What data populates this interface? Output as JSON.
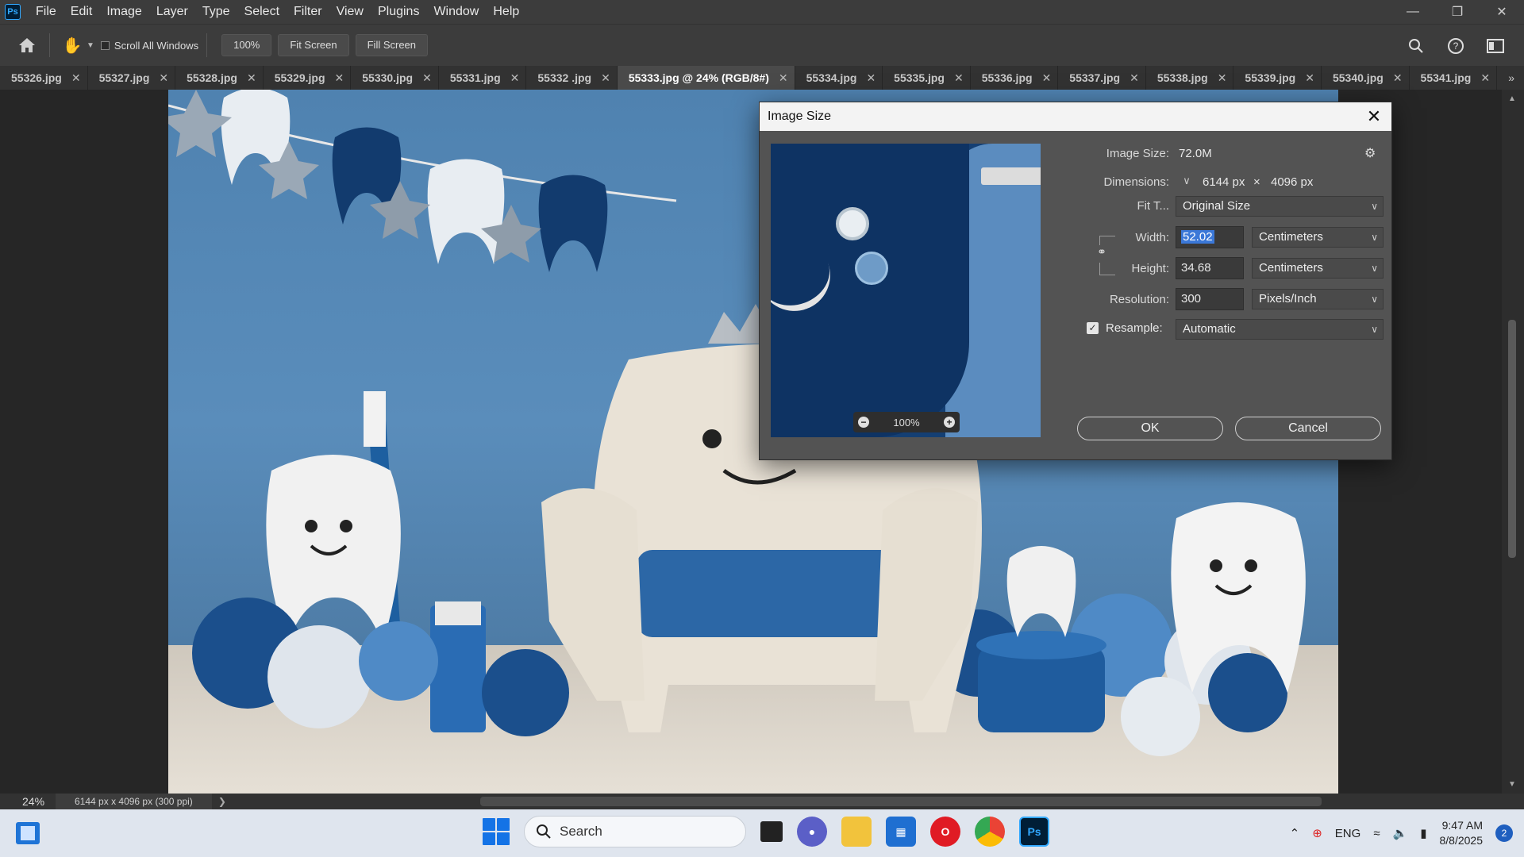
{
  "menubar": {
    "app_icon": "Ps",
    "items": [
      "File",
      "Edit",
      "Image",
      "Layer",
      "Type",
      "Select",
      "Filter",
      "View",
      "Plugins",
      "Window",
      "Help"
    ],
    "window_controls": [
      "minimize-icon",
      "restore-icon",
      "close-icon"
    ]
  },
  "optionsbar": {
    "scroll_all_windows": "Scroll All Windows",
    "zoom_100": "100%",
    "fit_screen": "Fit Screen",
    "fill_screen": "Fill Screen",
    "icons": [
      "home-icon",
      "hand-tool-icon",
      "search-icon",
      "help-icon",
      "workspace-icon"
    ]
  },
  "tabs": [
    {
      "label": "55326.jpg",
      "active": false
    },
    {
      "label": "55327.jpg",
      "active": false
    },
    {
      "label": "55328.jpg",
      "active": false
    },
    {
      "label": "55329.jpg",
      "active": false
    },
    {
      "label": "55330.jpg",
      "active": false
    },
    {
      "label": "55331.jpg",
      "active": false
    },
    {
      "label": "55332 .jpg",
      "active": false
    },
    {
      "label": "55333.jpg @ 24% (RGB/8#)",
      "active": true
    },
    {
      "label": "55334.jpg",
      "active": false
    },
    {
      "label": "55335.jpg",
      "active": false
    },
    {
      "label": "55336.jpg",
      "active": false
    },
    {
      "label": "55337.jpg",
      "active": false
    },
    {
      "label": "55338.jpg",
      "active": false
    },
    {
      "label": "55339.jpg",
      "active": false
    },
    {
      "label": "55340.jpg",
      "active": false
    },
    {
      "label": "55341.jpg",
      "active": false
    }
  ],
  "statusbar": {
    "zoom": "24%",
    "doc_info": "6144 px x 4096 px (300 ppi)"
  },
  "dialog": {
    "title": "Image Size",
    "image_size_label": "Image Size:",
    "image_size_value": "72.0M",
    "dimensions_label": "Dimensions:",
    "dim_width": "6144 px",
    "dim_x": "×",
    "dim_height": "4096 px",
    "fit_to_label": "Fit T...",
    "fit_to_value": "Original Size",
    "width_label": "Width:",
    "width_value": "52.02",
    "width_unit": "Centimeters",
    "height_label": "Height:",
    "height_value": "34.68",
    "height_unit": "Centimeters",
    "resolution_label": "Resolution:",
    "resolution_value": "300",
    "resolution_unit": "Pixels/Inch",
    "resample_label": "Resample:",
    "resample_checked": true,
    "resample_value": "Automatic",
    "preview_zoom": "100%",
    "ok": "OK",
    "cancel": "Cancel"
  },
  "taskbar": {
    "search_placeholder": "Search",
    "language": "ENG",
    "time": "9:47 AM",
    "date": "8/8/2025",
    "notification_count": "2",
    "apps": [
      "widgets-icon",
      "start-icon",
      "task-view-icon",
      "teams-icon",
      "file-explorer-icon",
      "microsoft-store-icon",
      "opera-icon",
      "chrome-icon",
      "photoshop-icon"
    ]
  },
  "colors": {
    "ps_blue": "#31a8ff",
    "selection_blue": "#3b78d8",
    "dialog_bg": "#535353"
  }
}
